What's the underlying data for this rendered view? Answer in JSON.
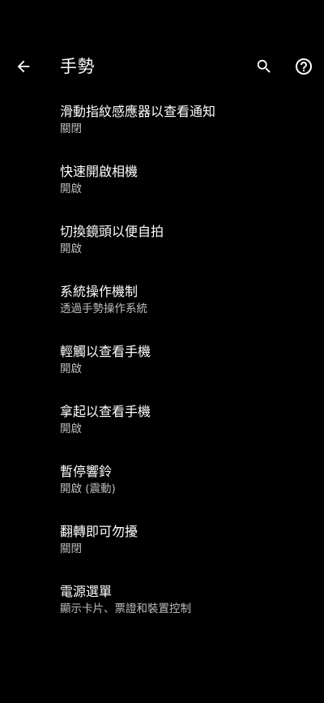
{
  "header": {
    "title": "手勢",
    "back_icon": "arrow-back-icon",
    "search_icon": "search-icon",
    "help_icon": "help-icon"
  },
  "colors": {
    "background": "#000000",
    "title_text": "#ffffff",
    "summary_text": "#bdbdbd"
  },
  "items": [
    {
      "title": "滑動指紋感應器以查看通知",
      "summary": "關閉"
    },
    {
      "title": "快速開啟相機",
      "summary": "開啟"
    },
    {
      "title": "切換鏡頭以便自拍",
      "summary": "開啟"
    },
    {
      "title": "系統操作機制",
      "summary": "透過手勢操作系統"
    },
    {
      "title": "輕觸以查看手機",
      "summary": "開啟"
    },
    {
      "title": "拿起以查看手機",
      "summary": "開啟"
    },
    {
      "title": "暫停響鈴",
      "summary": "開啟 (震動)"
    },
    {
      "title": "翻轉即可勿擾",
      "summary": "關閉"
    },
    {
      "title": "電源選單",
      "summary": "顯示卡片、票證和裝置控制"
    }
  ]
}
